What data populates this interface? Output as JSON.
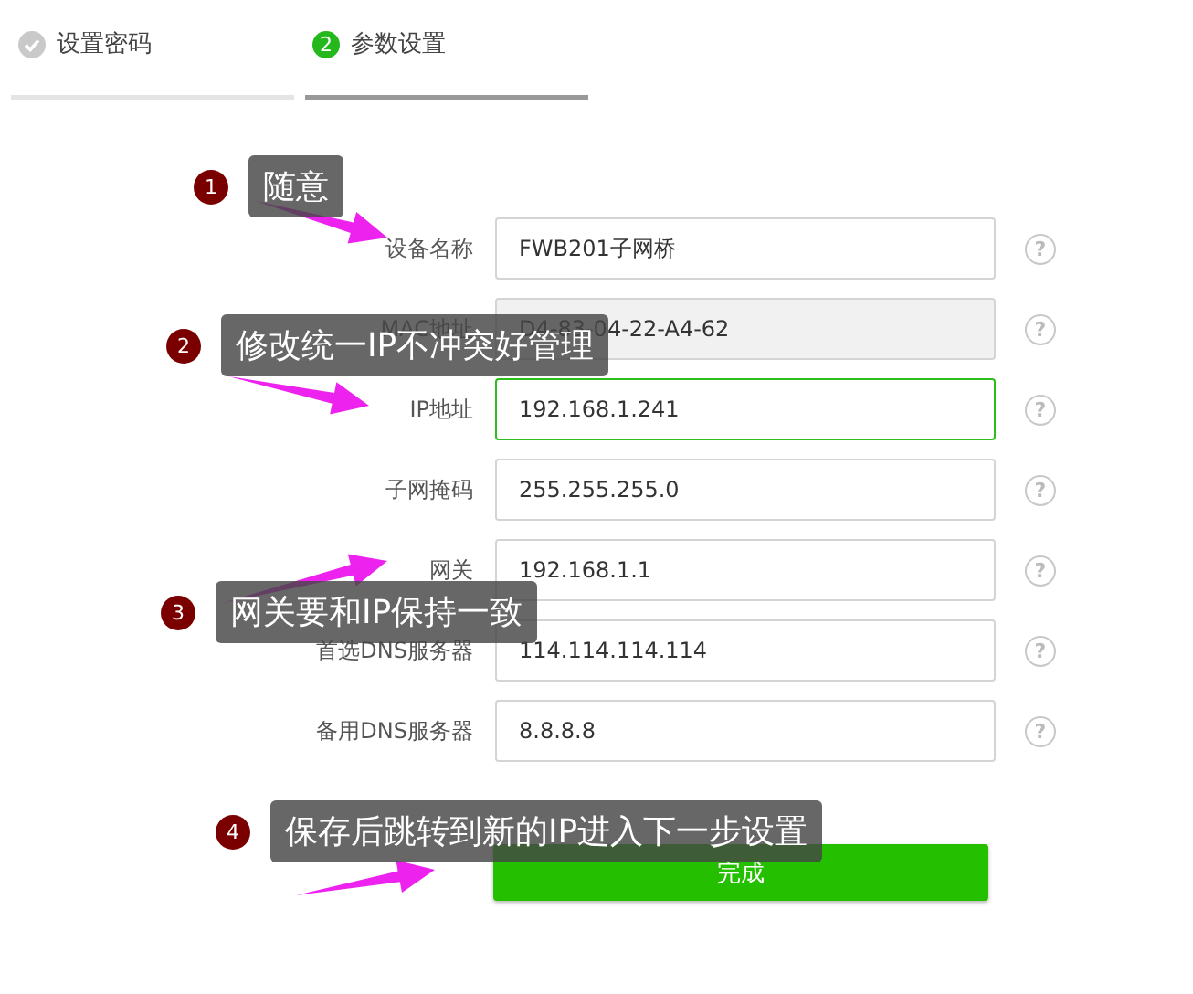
{
  "tabs": [
    {
      "label": "设置密码",
      "done": true,
      "selected": false
    },
    {
      "label": "参数设置",
      "step": "2",
      "done": false,
      "selected": true
    }
  ],
  "fields": [
    {
      "label": "设备名称",
      "value": "FWB201子网桥",
      "disabled": false,
      "focused": false
    },
    {
      "label": "MAC地址",
      "value": "D4-83-04-22-A4-62",
      "disabled": true,
      "focused": false
    },
    {
      "label": "IP地址",
      "value": "192.168.1.241",
      "disabled": false,
      "focused": true
    },
    {
      "label": "子网掩码",
      "value": "255.255.255.0",
      "disabled": false,
      "focused": false
    },
    {
      "label": "网关",
      "value": "192.168.1.1",
      "disabled": false,
      "focused": false
    },
    {
      "label": "首选DNS服务器",
      "value": "114.114.114.114",
      "disabled": false,
      "focused": false
    },
    {
      "label": "备用DNS服务器",
      "value": "8.8.8.8",
      "disabled": false,
      "focused": false
    }
  ],
  "help_mark": "?",
  "submit_button": "完成",
  "callouts": [
    {
      "number": "1",
      "text": "随意"
    },
    {
      "number": "2",
      "text": "修改统一IP不冲突好管理"
    },
    {
      "number": "3",
      "text": "网关要和IP保持一致"
    },
    {
      "number": "4",
      "text": "保存后跳转到新的IP进入下一步设置"
    }
  ]
}
